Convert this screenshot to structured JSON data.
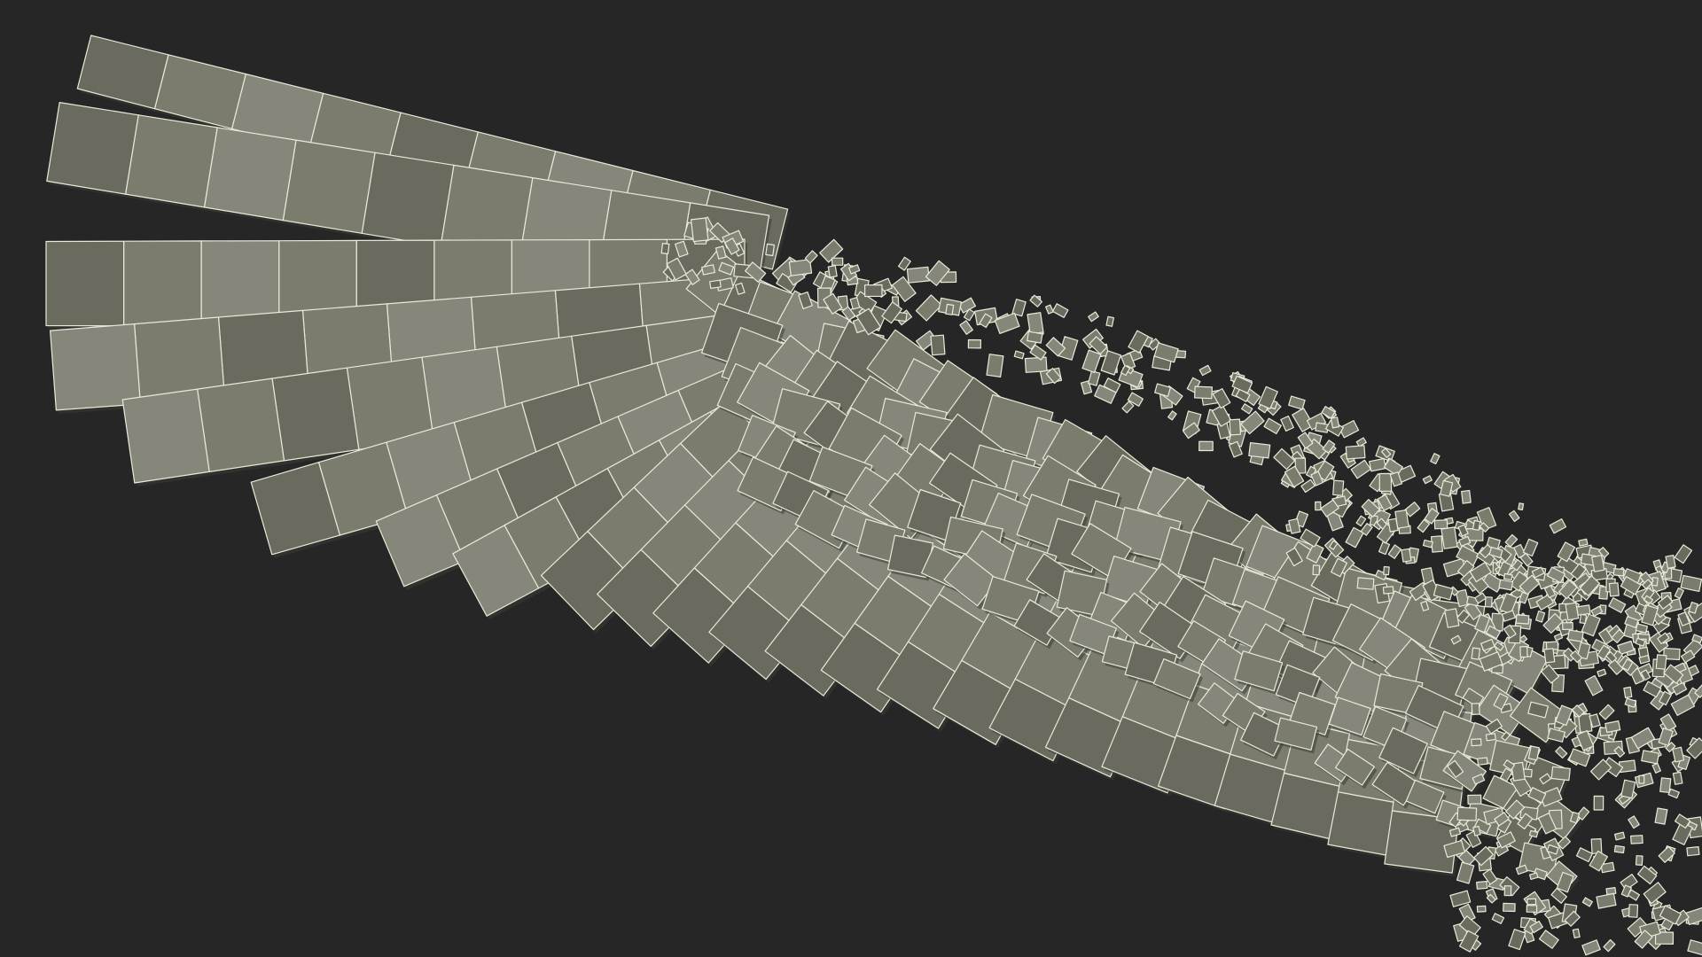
{
  "scene": {
    "subject": "wing-wireframe-model",
    "background_color": "#262626",
    "face_color": "#7b7c6e",
    "face_color_dark": "#6a6b5e",
    "face_color_light": "#86877a",
    "wire_color": "#e7ead8",
    "shadow_color": "#3a3a34"
  }
}
